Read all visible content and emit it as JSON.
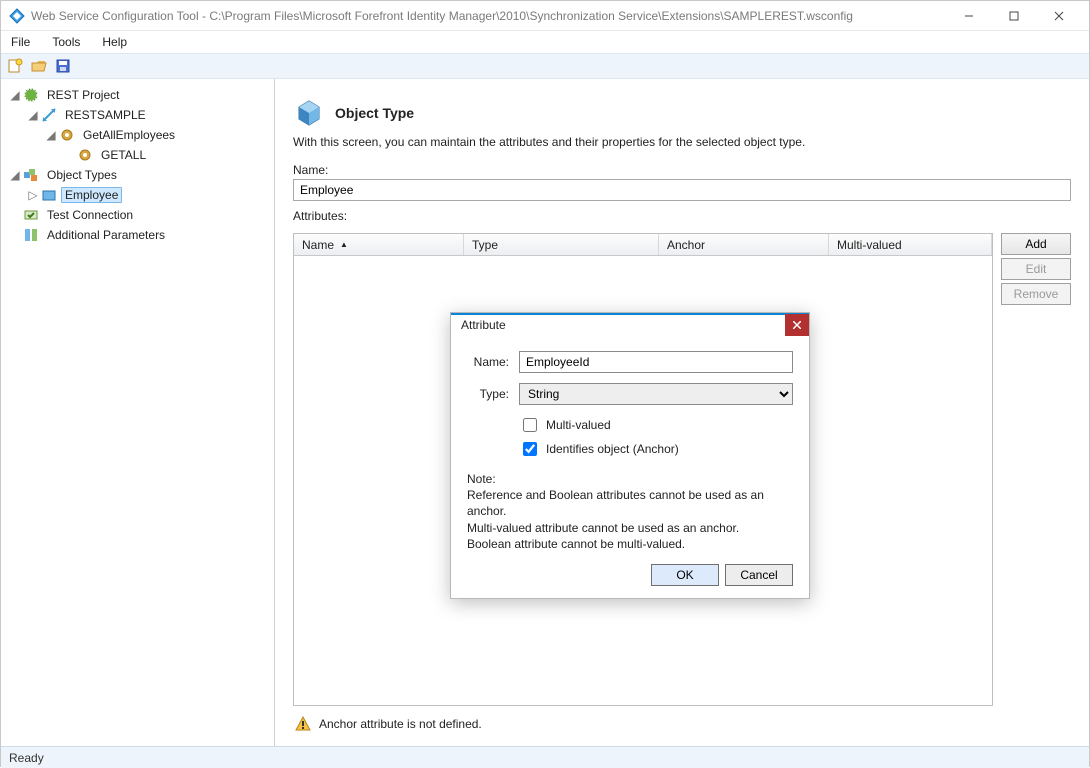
{
  "window": {
    "title": "Web Service Configuration Tool - C:\\Program Files\\Microsoft Forefront Identity Manager\\2010\\Synchronization Service\\Extensions\\SAMPLEREST.wsconfig"
  },
  "menu": {
    "file": "File",
    "tools": "Tools",
    "help": "Help"
  },
  "toolbar_icons": {
    "new": "new-icon",
    "open": "open-icon",
    "save": "save-icon"
  },
  "tree": {
    "root": "REST Project",
    "sample": "RESTSAMPLE",
    "getall_group": "GetAllEmployees",
    "getall": "GETALL",
    "object_types": "Object Types",
    "employee": "Employee",
    "test_conn": "Test Connection",
    "addl_params": "Additional Parameters"
  },
  "main": {
    "heading": "Object Type",
    "description": "With this screen, you can maintain the attributes and their properties for the selected object type.",
    "name_label": "Name:",
    "name_value": "Employee",
    "attributes_label": "Attributes:",
    "columns": {
      "name": "Name",
      "type": "Type",
      "anchor": "Anchor",
      "multi": "Multi-valued"
    },
    "buttons": {
      "add": "Add",
      "edit": "Edit",
      "remove": "Remove"
    },
    "warning": "Anchor attribute is not defined."
  },
  "dialog": {
    "title": "Attribute",
    "name_label": "Name:",
    "name_value": "EmployeeId",
    "type_label": "Type:",
    "type_value": "String",
    "multi_label": "Multi-valued",
    "multi_checked": false,
    "anchor_label": "Identifies object (Anchor)",
    "anchor_checked": true,
    "note_label": "Note:",
    "note_line1": "Reference and Boolean attributes cannot be used as an anchor.",
    "note_line2": "Multi-valued attribute cannot be used as an anchor.",
    "note_line3": "Boolean attribute cannot be multi-valued.",
    "ok": "OK",
    "cancel": "Cancel"
  },
  "status": {
    "text": "Ready"
  }
}
